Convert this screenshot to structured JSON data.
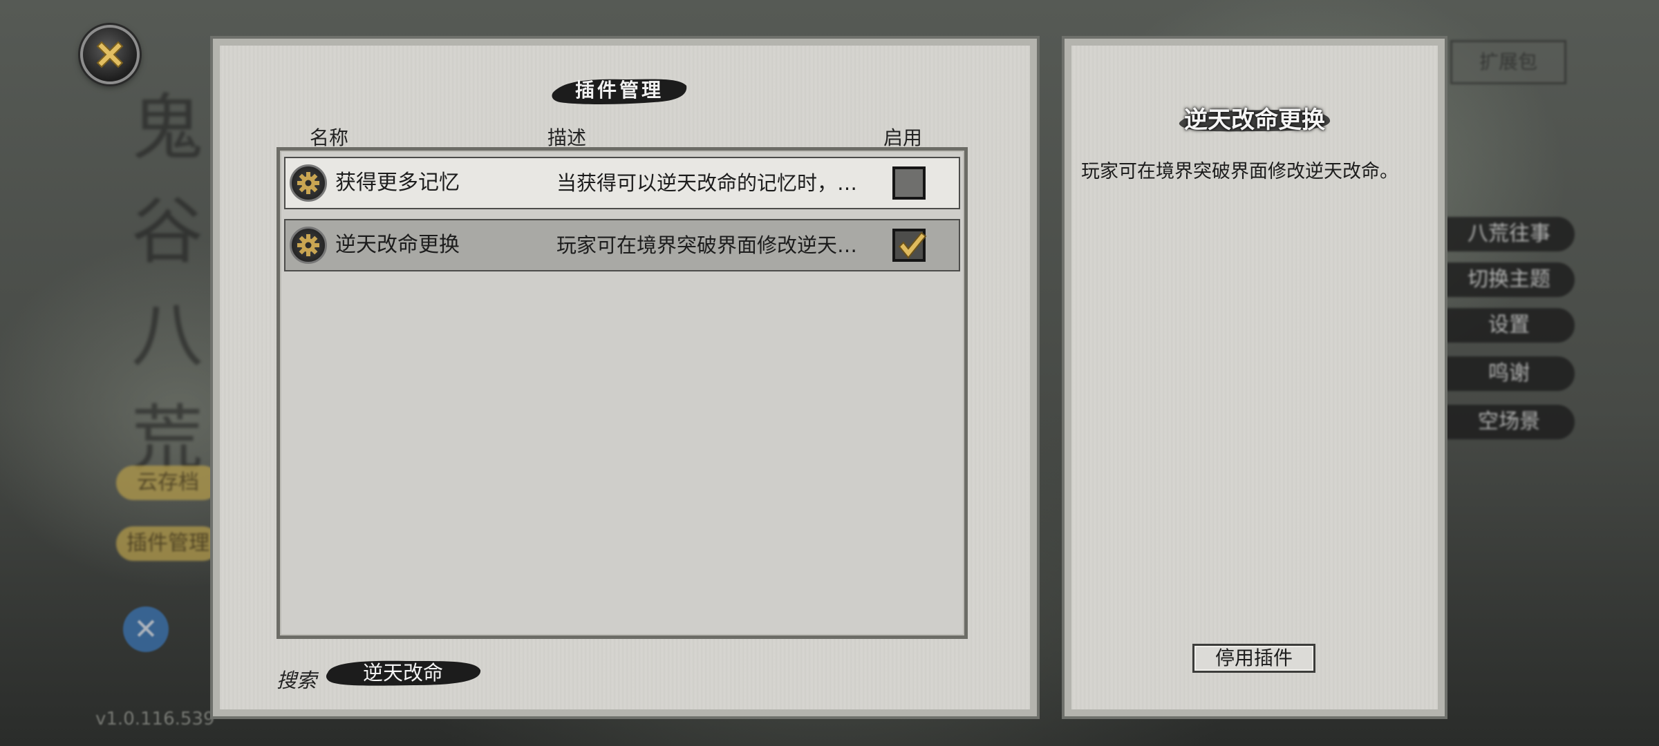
{
  "background": {
    "game_title": "鬼谷八荒",
    "left_buttons": [
      "云存档",
      "插件管理"
    ],
    "right_menu": [
      "八荒往事",
      "切换主题",
      "设置",
      "鸣谢",
      "空场景"
    ],
    "top_right_button": "扩展包",
    "version": "v1.0.116.539"
  },
  "close_button": {
    "icon": "close-x-icon"
  },
  "plugin_manager": {
    "title": "插件管理",
    "columns": {
      "name": "名称",
      "description": "描述",
      "enabled": "启用"
    },
    "rows": [
      {
        "name": "获得更多记忆",
        "description": "当获得可以逆天改命的记忆时，…",
        "enabled": false,
        "icon": "gear-icon"
      },
      {
        "name": "逆天改命更换",
        "description": "玩家可在境界突破界面修改逆天…",
        "enabled": true,
        "icon": "gear-icon"
      }
    ],
    "search": {
      "label": "搜索",
      "value": "逆天改命"
    }
  },
  "detail": {
    "title": "逆天改命更换",
    "description": "玩家可在境界突破界面修改逆天改命。",
    "disable_button": "停用插件"
  },
  "colors": {
    "panel": "#d5d4cf",
    "ink": "#1b1b1b",
    "gold": "#d9b45c"
  }
}
